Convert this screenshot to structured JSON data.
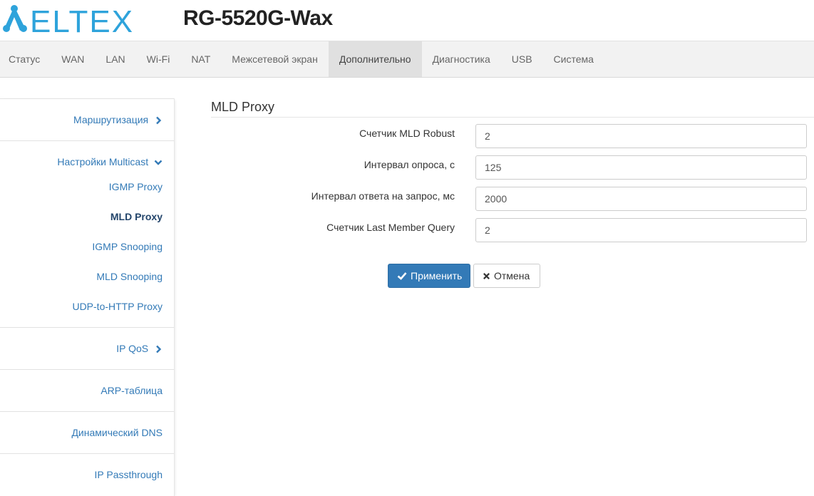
{
  "header": {
    "logo_text": "ELTEX",
    "model": "RG-5520G-Wax"
  },
  "nav": {
    "items": [
      "Статус",
      "WAN",
      "LAN",
      "Wi-Fi",
      "NAT",
      "Межсетевой экран",
      "Дополнительно",
      "Диагностика",
      "USB",
      "Система"
    ],
    "active": "Дополнительно"
  },
  "sidebar": {
    "routing": "Маршрутизация",
    "multicast": "Настройки Multicast",
    "multicast_items": [
      "IGMP Proxy",
      "MLD Proxy",
      "IGMP Snooping",
      "MLD Snooping",
      "UDP-to-HTTP Proxy"
    ],
    "active_item": "MLD Proxy",
    "ipqos": "IP QoS",
    "arp": "ARP-таблица",
    "ddns": "Динамический DNS",
    "passthrough": "IP Passthrough"
  },
  "content": {
    "title": "MLD Proxy",
    "fields": [
      {
        "label": "Счетчик MLD Robust",
        "value": "2"
      },
      {
        "label": "Интервал опроса, с",
        "value": "125"
      },
      {
        "label": "Интервал ответа на запрос, мс",
        "value": "2000"
      },
      {
        "label": "Счетчик Last Member Query",
        "value": "2"
      }
    ],
    "apply_label": "Применить",
    "cancel_label": "Отмена"
  },
  "colors": {
    "brand": "#2ea3db",
    "link": "#337ab7",
    "primary_button": "#337ab7"
  }
}
